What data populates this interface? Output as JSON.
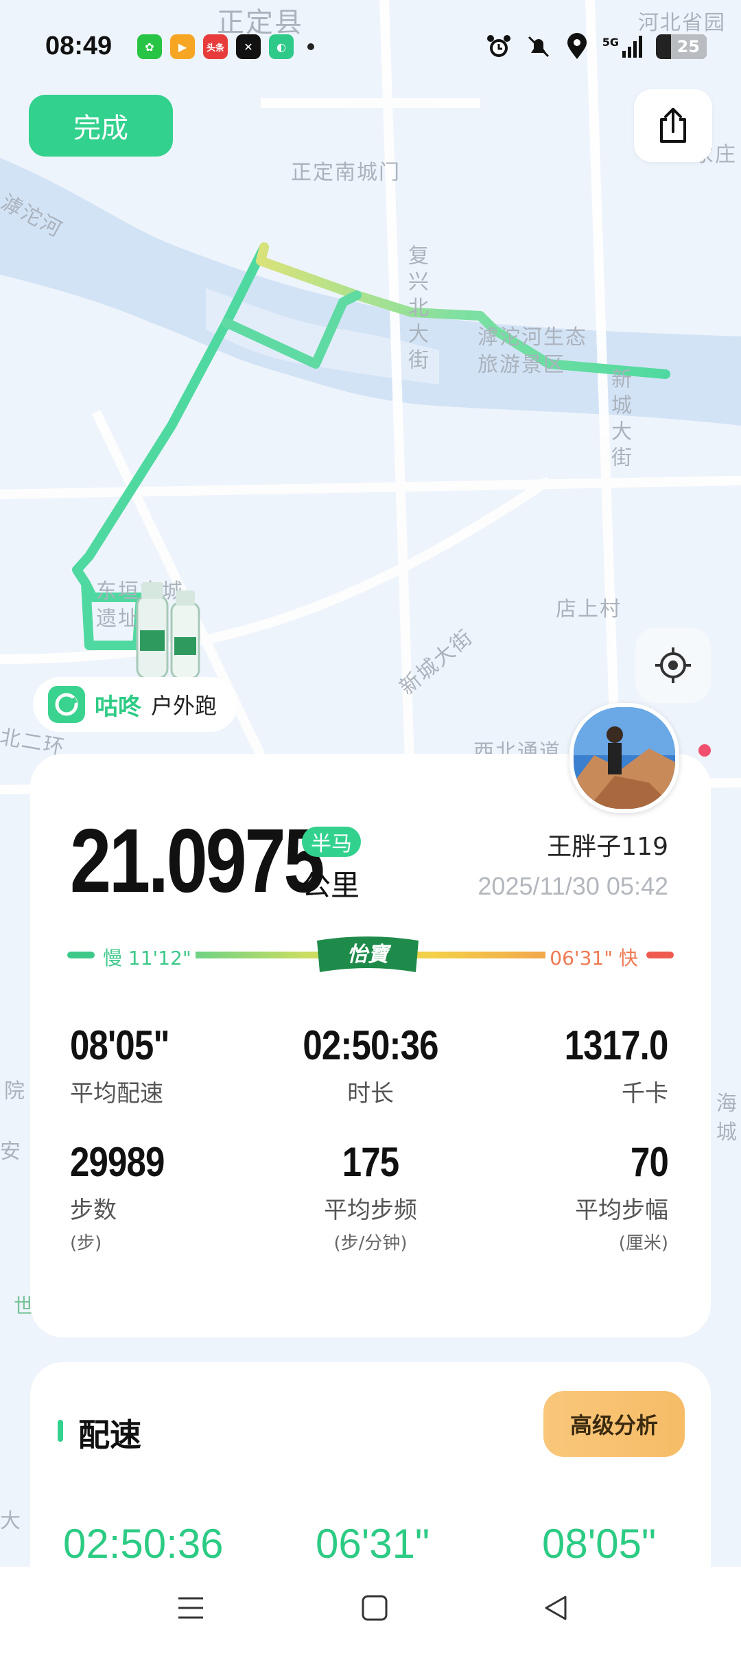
{
  "status_bar": {
    "time": "08:49",
    "apps": [
      {
        "name": "wechat-icon",
        "color": "#28c445",
        "glyph": "✿"
      },
      {
        "name": "video-app-icon",
        "color": "#f6a623",
        "glyph": "▶"
      },
      {
        "name": "toutiao-icon",
        "color": "#e83c3c",
        "glyph": "头条"
      },
      {
        "name": "capcut-icon",
        "color": "#111111",
        "glyph": "✕"
      },
      {
        "name": "gudong-icon",
        "color": "#2fc98a",
        "glyph": "◐"
      }
    ],
    "network": "5G",
    "battery": "25"
  },
  "buttons": {
    "done": "完成"
  },
  "map": {
    "labels": {
      "county": "正定县",
      "province_garden": "河北省园",
      "south_gate": "正定南城门",
      "hutuo_river": "滹沱河",
      "fuxing_street": "复兴北大街",
      "eco_zone_1": "滹沱河生态",
      "eco_zone_2": "旅游景区",
      "xincheng_street": "新城大街",
      "ancient_site_1": "东垣古城",
      "ancient_site_2": "遗址",
      "dianshang": "店上村",
      "xincheng_diag": "新城大街",
      "bei_er_huan": "北二环",
      "xibei_tong": "西北通道",
      "jia_zhuang": "家庄",
      "hai": "海",
      "cheng": "城",
      "yuan": "院",
      "an": "安",
      "shi": "世",
      "da": "大"
    }
  },
  "brand": {
    "name": "咕咚",
    "sub": "户外跑"
  },
  "summary": {
    "distance": "21.0975",
    "badge": "半马",
    "unit": "公里",
    "username": "王胖子119",
    "datetime": "2025/11/30 05:42",
    "pace_slow": "慢 11'12\"",
    "pace_fast": "06'31\" 快",
    "sponsor": "怡寶",
    "stats": [
      {
        "value": "08'05\"",
        "label": "平均配速",
        "unit": ""
      },
      {
        "value": "02:50:36",
        "label": "时长",
        "unit": ""
      },
      {
        "value": "1317.0",
        "label": "千卡",
        "unit": ""
      },
      {
        "value": "29989",
        "label": "步数",
        "unit": "(步)"
      },
      {
        "value": "175",
        "label": "平均步频",
        "unit": "(步/分钟)"
      },
      {
        "value": "70",
        "label": "平均步幅",
        "unit": "(厘米)"
      }
    ]
  },
  "pace_section": {
    "title": "配速",
    "advanced_button": "高级分析",
    "values": [
      "02:50:36",
      "06'31\"",
      "08'05\""
    ]
  },
  "colors": {
    "accent": "#32d18e",
    "route_start": "#4fd9a0",
    "route_end": "#d9e27a",
    "slow": "#3ec98a",
    "fast": "#ef5a4f"
  }
}
